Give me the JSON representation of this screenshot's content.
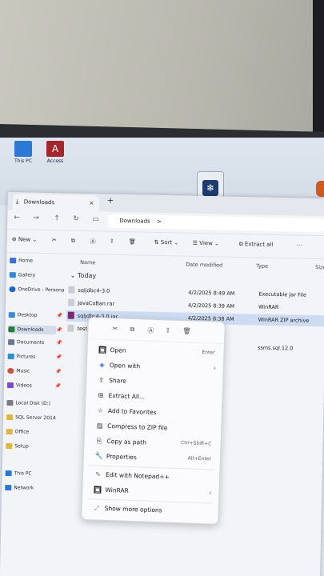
{
  "desktop": {
    "icons": [
      {
        "label": "This PC",
        "color": "#2b79d6"
      },
      {
        "label": "Access",
        "color": "#a4262c"
      }
    ]
  },
  "window": {
    "tab_title": "Downloads",
    "tab_close": "×",
    "new_tab": "+"
  },
  "nav": {
    "back": "←",
    "forward": "→",
    "up": "↑",
    "refresh": "↻",
    "path": "Downloads",
    "path_sep": ">"
  },
  "command_bar": {
    "new": "New",
    "cut": "✂",
    "copy": "⧉",
    "rename": "Ⓐ",
    "share": "⇪",
    "delete": "🗑",
    "sort": "Sort",
    "view": "View",
    "extract": "Extract all",
    "more": "···"
  },
  "sidebar": {
    "items": [
      {
        "label": "Home",
        "color": "#3b6fd6"
      },
      {
        "label": "Gallery",
        "color": "#2f8bd6"
      },
      {
        "label": "OneDrive - Persona",
        "color": "#1b66c9"
      },
      {
        "label": "Desktop",
        "color": "#3a86d8",
        "pin": "📌"
      },
      {
        "label": "Downloads",
        "color": "#2a7a3c",
        "pin": "📌"
      },
      {
        "label": "Documents",
        "color": "#6a7790",
        "pin": "📌"
      },
      {
        "label": "Pictures",
        "color": "#2a8fcf",
        "pin": "📌"
      },
      {
        "label": "Music",
        "color": "#d0503a",
        "pin": "📌"
      },
      {
        "label": "Videos",
        "color": "#7a4cc4",
        "pin": "📌"
      },
      {
        "label": "Local Disk (D:)",
        "color": "#777c86"
      },
      {
        "label": "SQL Server 2014",
        "color": "#e2b540"
      },
      {
        "label": "Office",
        "color": "#e2b540"
      },
      {
        "label": "Setup",
        "color": "#e2b540"
      },
      {
        "label": "This PC",
        "color": "#2b79d6"
      },
      {
        "label": "Network",
        "color": "#2b79d6"
      }
    ]
  },
  "columns": {
    "name": "Name",
    "date": "Date modified",
    "type": "Type",
    "size": "Size"
  },
  "group": "Today",
  "files": [
    {
      "name": "sqljdbc4-3.0",
      "date": "4/2/2025 8:49 AM",
      "type": "Executable Jar File",
      "color": "#c9cdd5"
    },
    {
      "name": "JavaCoBan.rar",
      "date": "4/2/2025 8:39 AM",
      "type": "WinRAR",
      "color": "#c9cdd5"
    },
    {
      "name": "sqljdbc4-3.0.jar",
      "date": "4/2/2025 8:38 AM",
      "type": "WinRAR ZIP archive",
      "color": "#7b2a6e"
    },
    {
      "name": "test.sql",
      "date": "",
      "type": "ssms.sql.12.0",
      "color": "#c9cdd5"
    }
  ],
  "context_menu": {
    "quick": [
      "✂",
      "⧉",
      "Ⓐ",
      "⇪",
      "🗑"
    ],
    "items": [
      {
        "label": "Open",
        "key": "Enter",
        "icon": "▣"
      },
      {
        "label": "Open with",
        "key": "",
        "icon": "◈",
        "submenu": "›"
      },
      {
        "label": "Share",
        "key": "",
        "icon": "⇪"
      },
      {
        "label": "Extract All...",
        "key": "",
        "icon": "⊞"
      },
      {
        "label": "Add to Favorites",
        "key": "",
        "icon": "☆"
      },
      {
        "label": "Compress to ZIP file",
        "key": "",
        "icon": "▤"
      },
      {
        "label": "Copy as path",
        "key": "Ctrl+Shift+C",
        "icon": "⎘"
      },
      {
        "label": "Properties",
        "key": "Alt+Enter",
        "icon": "🔧"
      },
      {
        "label": "Edit with Notepad++",
        "key": "",
        "icon": "✎"
      },
      {
        "label": "WinRAR",
        "key": "",
        "icon": "▣",
        "submenu": "›"
      },
      {
        "label": "Show more options",
        "key": "",
        "icon": "⤢"
      }
    ]
  }
}
